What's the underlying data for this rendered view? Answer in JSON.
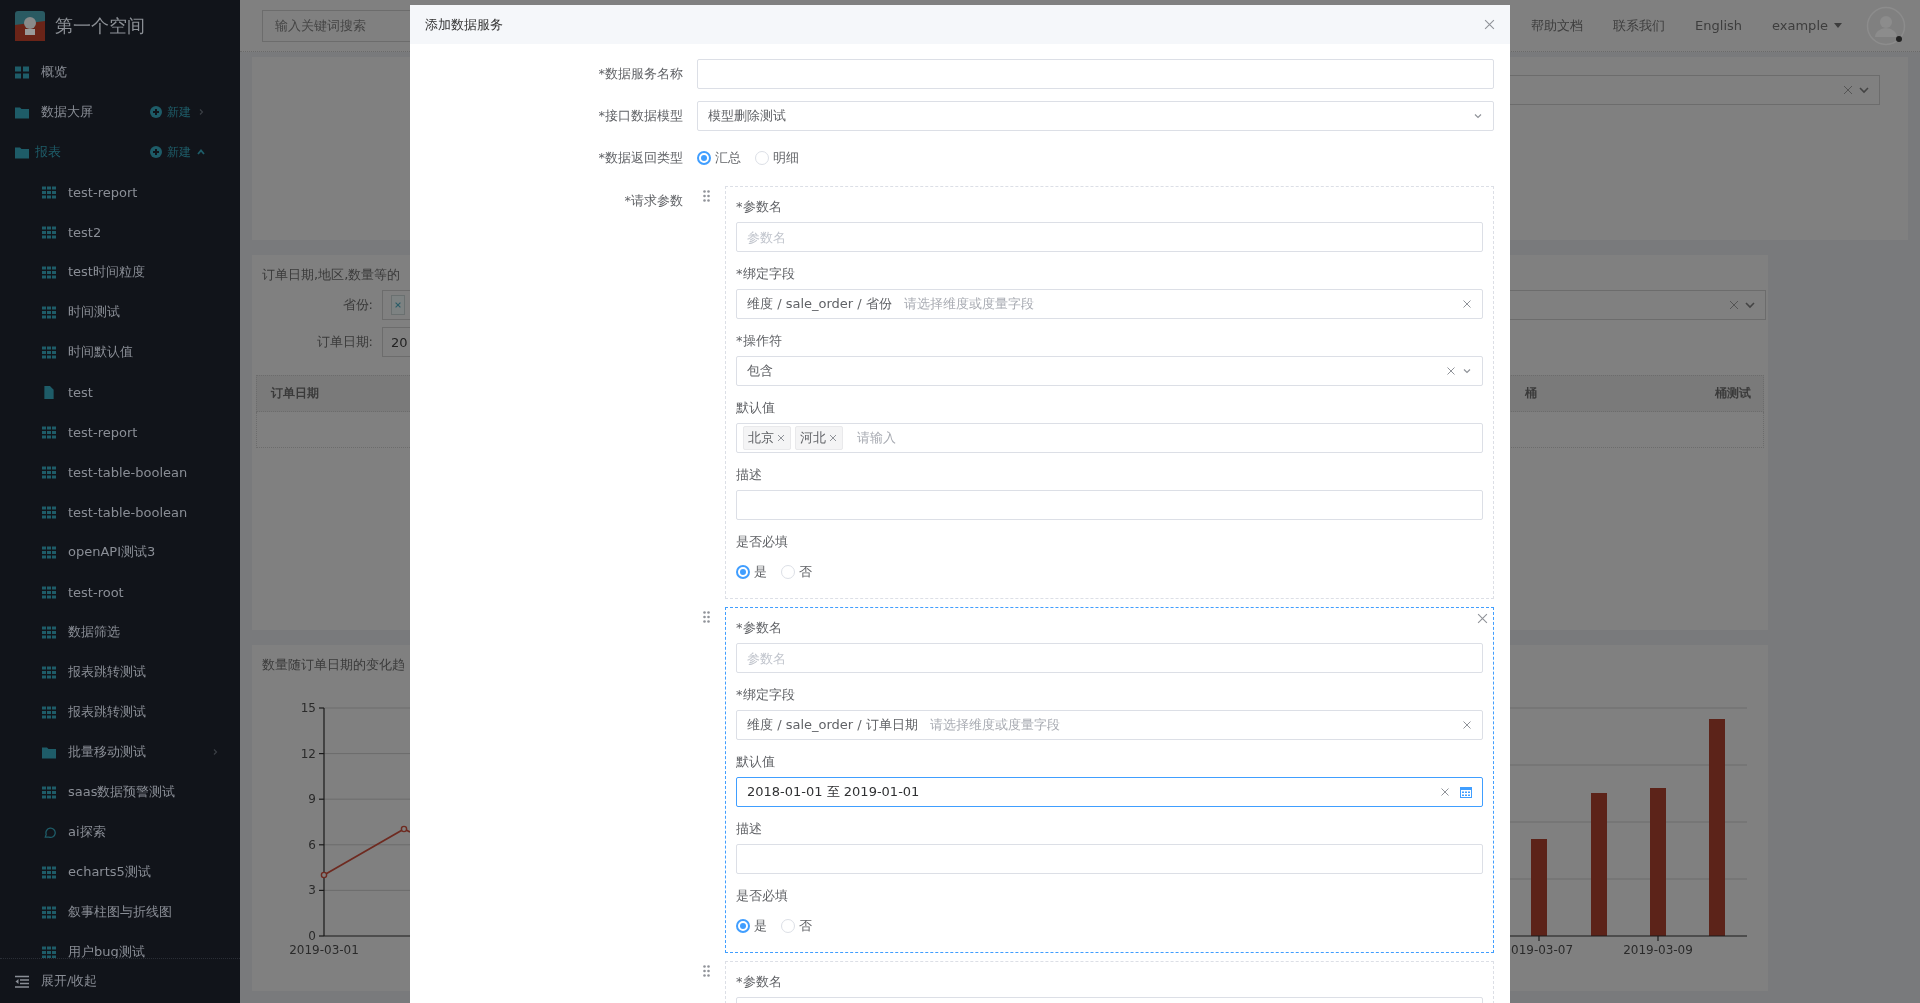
{
  "sidebar": {
    "title": "第一个空间",
    "items": [
      {
        "label": "概览",
        "kind": "overview",
        "selected": false
      },
      {
        "label": "数据大屏",
        "kind": "folder",
        "selected": false,
        "action": "新建",
        "expanded": false
      },
      {
        "label": "报表",
        "kind": "folder",
        "selected": true,
        "action": "新建",
        "expanded": true,
        "children": [
          {
            "label": "test-report",
            "kind": "report",
            "selected": false
          },
          {
            "label": "test2",
            "kind": "report",
            "selected": false
          },
          {
            "label": "test时间粒度",
            "kind": "report",
            "selected": false
          },
          {
            "label": "时间测试",
            "kind": "report",
            "selected": false
          },
          {
            "label": "时间默认值",
            "kind": "report",
            "selected": false
          },
          {
            "label": "test",
            "kind": "doc",
            "selected": false
          },
          {
            "label": "test-report",
            "kind": "report",
            "selected": false
          },
          {
            "label": "test-table-boolean",
            "kind": "report",
            "selected": false
          },
          {
            "label": "test-table-boolean",
            "kind": "report",
            "selected": false
          },
          {
            "label": "openAPI测试3",
            "kind": "report",
            "selected": false
          },
          {
            "label": "test-root",
            "kind": "report",
            "selected": false
          },
          {
            "label": "数据筛选",
            "kind": "report",
            "selected": false
          },
          {
            "label": "报表跳转测试",
            "kind": "report",
            "selected": false
          },
          {
            "label": "报表跳转测试",
            "kind": "report",
            "selected": false
          },
          {
            "label": "批量移动测试",
            "kind": "folder",
            "selected": false,
            "expanded": false
          },
          {
            "label": "saas数据预警测试",
            "kind": "report",
            "selected": false
          },
          {
            "label": "ai探索",
            "kind": "ai",
            "selected": false
          },
          {
            "label": "echarts5测试",
            "kind": "report",
            "selected": false
          },
          {
            "label": "叙事柱图与折线图",
            "kind": "report",
            "selected": false
          },
          {
            "label": "用户bug测试",
            "kind": "report",
            "selected": false
          }
        ]
      }
    ],
    "footer": "展开/收起"
  },
  "header": {
    "search_placeholder": "输入关键词搜索",
    "links": [
      "帮助文档",
      "联系我们",
      "English"
    ],
    "user": "example"
  },
  "report": {
    "filter_card": {
      "title": "订单日期,地区,数量等的",
      "filters": [
        {
          "label": "省份:",
          "kind": "multiselect"
        },
        {
          "label": "订单日期:",
          "kind": "date",
          "value": "20"
        }
      ],
      "columns": [
        "订单日期",
        "桶",
        "桶测试"
      ]
    },
    "chart_card": {
      "title": "数量随订单日期的变化趋",
      "y_labels": [
        "15",
        "12",
        "9",
        "6",
        "3",
        "0"
      ],
      "line_x_label": "2019-03-01",
      "bar_labels": [
        "019-03-07",
        "2019-03-09"
      ]
    }
  },
  "dialog": {
    "title": "添加数据服务",
    "fields": [
      {
        "kind": "text",
        "label": "*数据服务名称"
      },
      {
        "kind": "select",
        "label": "*接口数据模型",
        "value": "模型删除测试"
      },
      {
        "kind": "radio",
        "label": "*数据返回类型",
        "options": [
          {
            "label": "汇总",
            "selected": true
          },
          {
            "label": "明细",
            "selected": false
          }
        ]
      }
    ],
    "params_label": "*请求参数",
    "params": [
      {
        "active": false,
        "fields": [
          {
            "kind": "text",
            "label": "*参数名",
            "placeholder": "参数名"
          },
          {
            "kind": "cascader",
            "label": "*绑定字段",
            "value": "维度 / sale_order / 省份",
            "placeholder": "请选择维度或度量字段"
          },
          {
            "kind": "select",
            "label": "*操作符",
            "value": "包含",
            "clearable": true
          },
          {
            "kind": "tags",
            "label": "默认值",
            "tags": [
              "北京",
              "河北"
            ],
            "placeholder": "请输入"
          },
          {
            "kind": "text",
            "label": "描述"
          },
          {
            "kind": "radio",
            "label": "是否必填",
            "options": [
              {
                "label": "是",
                "selected": true
              },
              {
                "label": "否",
                "selected": false
              }
            ]
          }
        ]
      },
      {
        "active": true,
        "fields": [
          {
            "kind": "text",
            "label": "*参数名",
            "placeholder": "参数名"
          },
          {
            "kind": "cascader",
            "label": "*绑定字段",
            "value": "维度 / sale_order / 订单日期",
            "placeholder": "请选择维度或度量字段"
          },
          {
            "kind": "daterange",
            "label": "默认值",
            "value": "2018-01-01 至 2019-01-01"
          },
          {
            "kind": "text",
            "label": "描述"
          },
          {
            "kind": "radio",
            "label": "是否必填",
            "options": [
              {
                "label": "是",
                "selected": true
              },
              {
                "label": "否",
                "selected": false
              }
            ]
          }
        ]
      },
      {
        "active": false,
        "fields": [
          {
            "kind": "text",
            "label": "*参数名"
          }
        ]
      }
    ]
  }
}
